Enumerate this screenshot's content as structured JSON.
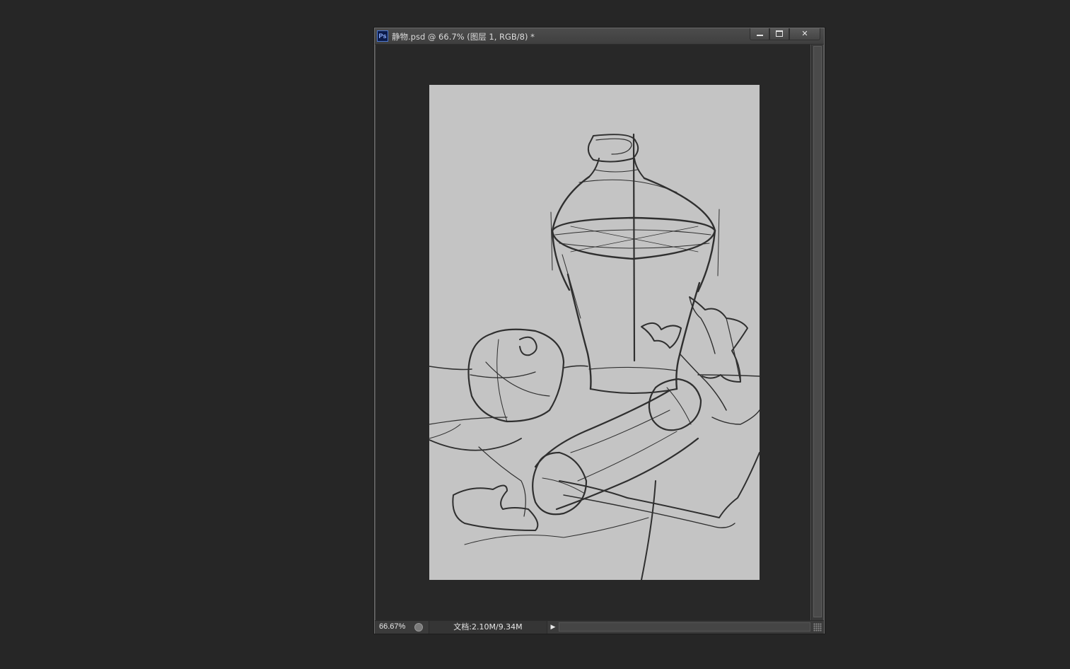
{
  "document": {
    "app_icon_label": "Ps",
    "title": "静物.psd @ 66.7% (图层 1, RGB/8) *",
    "controls": {
      "minimize": "▬",
      "maximize": "☐",
      "close": "✕"
    }
  },
  "statusbar": {
    "zoom": "66.67%",
    "doc_info": "文档:2.10M/9.34M",
    "menu_arrow": "▶"
  },
  "canvas": {
    "content": "pencil sketch still life",
    "background_color": "#c4c4c4",
    "stroke_color": "#2e2e2e"
  },
  "colors": {
    "workspace": "#262626",
    "pasteboard": "#282828",
    "titlebar": "#444444"
  }
}
